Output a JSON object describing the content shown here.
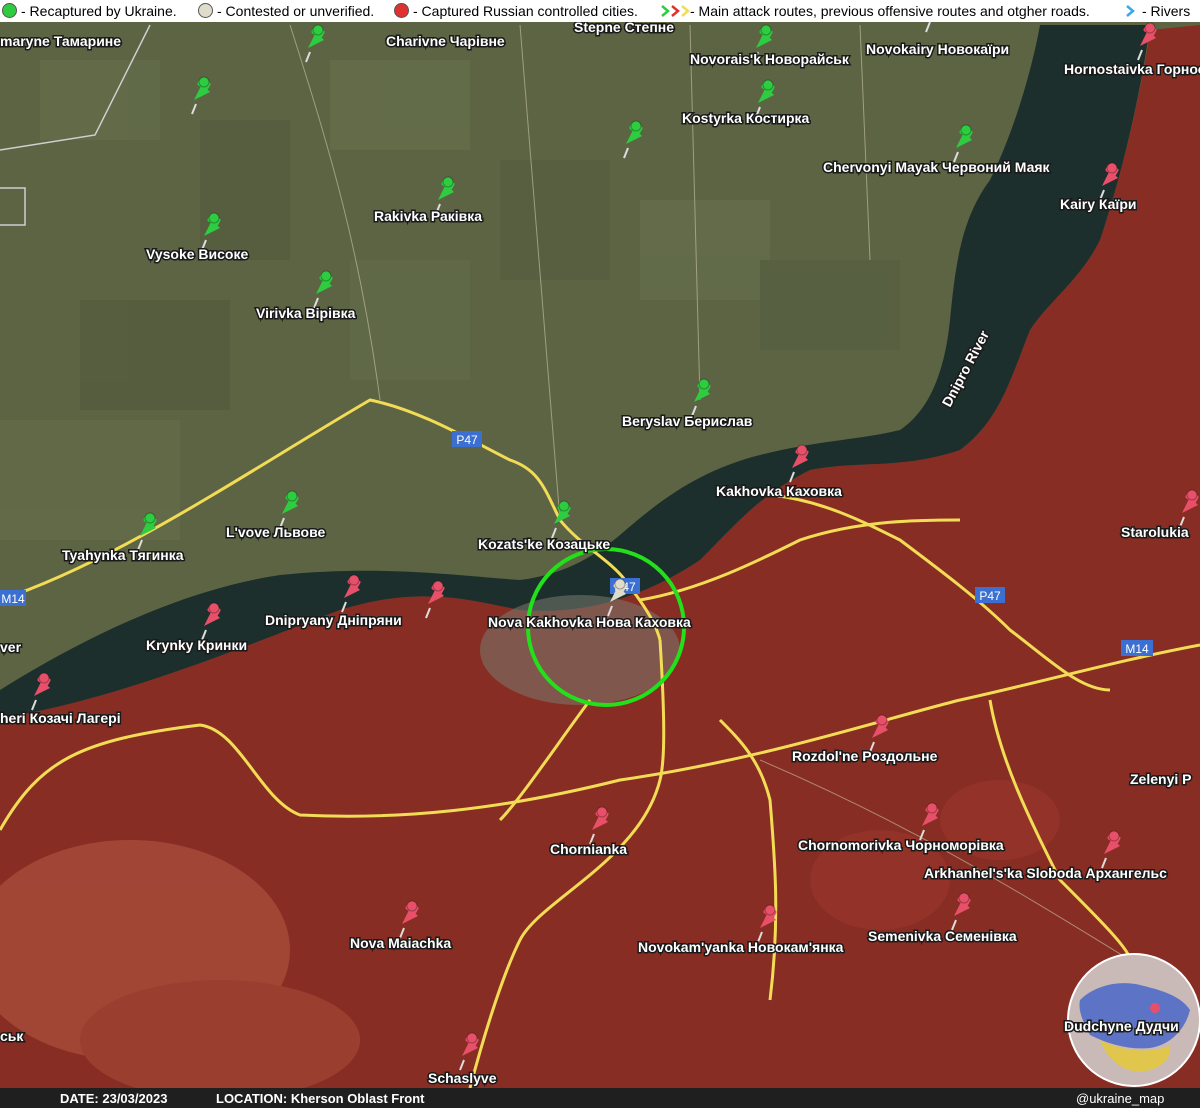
{
  "legend": {
    "recaptured": "- Recaptured by Ukraine.",
    "contested": "- Contested or unverified.",
    "captured": "- Captured Russian controlled cities.",
    "routes": "- Main attack routes, previous offensive routes and otgher roads.",
    "rivers": "- Rivers"
  },
  "colors": {
    "ukraine_pin": "#2ecc40",
    "russia_pin": "#e8506a",
    "contested_pin": "#e0dccb",
    "occupied_zone": "#8a2a22",
    "land": "#5c6444",
    "river": "#1c2f2c",
    "road": "#f2dc55"
  },
  "places": {
    "tamaryne": "marуne Тамарине",
    "charivne": "Charivne Чарівне",
    "stepne": "Stepne Степне",
    "novoraisk": "Novorais'k Новорайськ",
    "novokairy": "Novokairy Новокаїри",
    "hornostaivka": "Hornostaivka Горнос",
    "kostyrka": "Kostyrka Костирка",
    "chervonyi_mayak": "Chervonyi Mayak Червоний Маяк",
    "kairy": "Kairy Каїри",
    "rakivka": "Rakivka Раківка",
    "vysoke": "Vysoke Високе",
    "virivka": "Virivka Вірівка",
    "dnipro_river": "Dnipro River",
    "beryslav": "Beryslav Берислав",
    "kakhovka": "Kakhovka Каховка",
    "starolukia": "Starolukia",
    "lvove": "L'vove Львове",
    "kozatske": "Kozats'ke Козацьке",
    "tyahynka": "Tyahynka Тягинка",
    "nova_kakhovka": "Nova Kakhovka Нова Каховка",
    "dnipryany": "Dnipryany Дніпряни",
    "krynky": "Krynky Кринки",
    "kozachi_laheri": "heri Козачі Лагері",
    "river_edge": "ver",
    "rozdolne": "Rozdol'ne Роздольне",
    "zelenyi": "Zelenyi P",
    "chornianka": "Chornianka",
    "chornomorivka": "Chornomorivka Чорноморівка",
    "arkhanhelska": "Arkhanhel's'ka Sloboda Архангельс",
    "nova_maiachka": "Nova Maiachka",
    "novokamianka": "Novokam'yanka Новокам'янка",
    "semenivka": "Semenivka Семенівка",
    "dudchyne": "Dudchyne Дудчи",
    "schaslyve": "Schaslyve",
    "sk": "ськ"
  },
  "roads": {
    "p47_a": "P47",
    "p47_b": "P47",
    "p47_c": "P47",
    "m14_a": "M14",
    "m14_b": "M14"
  },
  "footer": {
    "date": "DATE: 23/03/2023",
    "location": "LOCATION: Kherson Oblast Front",
    "handle": "@ukraine_map"
  }
}
